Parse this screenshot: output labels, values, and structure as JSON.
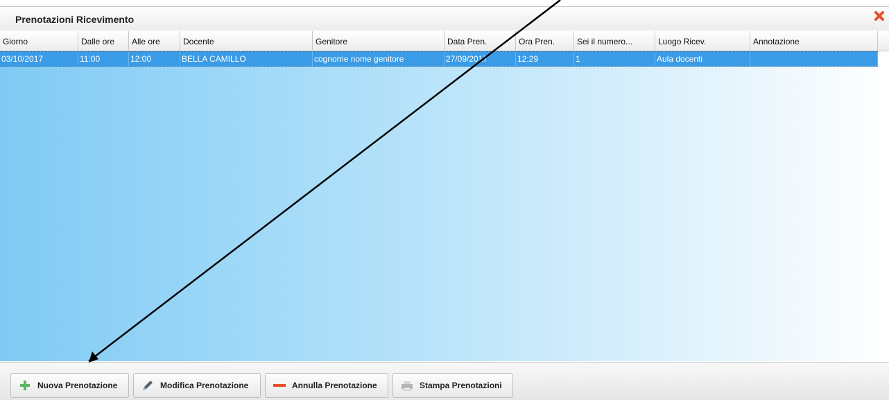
{
  "window": {
    "title": "Prenotazioni Ricevimento"
  },
  "grid": {
    "columns": [
      "Giorno",
      "Dalle ore",
      "Alle ore",
      "Docente",
      "Genitore",
      "Data Pren.",
      "Ora Pren.",
      "Sei il numero...",
      "Luogo Ricev.",
      "Annotazione"
    ],
    "rows": [
      [
        "03/10/2017",
        "11:00",
        "12:00",
        "BELLA CAMILLO",
        "cognome nome genitore",
        "27/09/2017",
        "12:29",
        "1",
        "Aula docenti",
        ""
      ]
    ],
    "selected_row": 0
  },
  "toolbar": {
    "nuova_label": "Nuova Prenotazione",
    "modifica_label": "Modifica Prenotazione",
    "annulla_label": "Annulla Prenotazione",
    "stampa_label": "Stampa Prenotazioni"
  },
  "colors": {
    "selected_row": "#3a9be6",
    "close_icon": "#e8512b",
    "add_icon": "#5cb85c",
    "remove_icon": "#e8512b"
  }
}
